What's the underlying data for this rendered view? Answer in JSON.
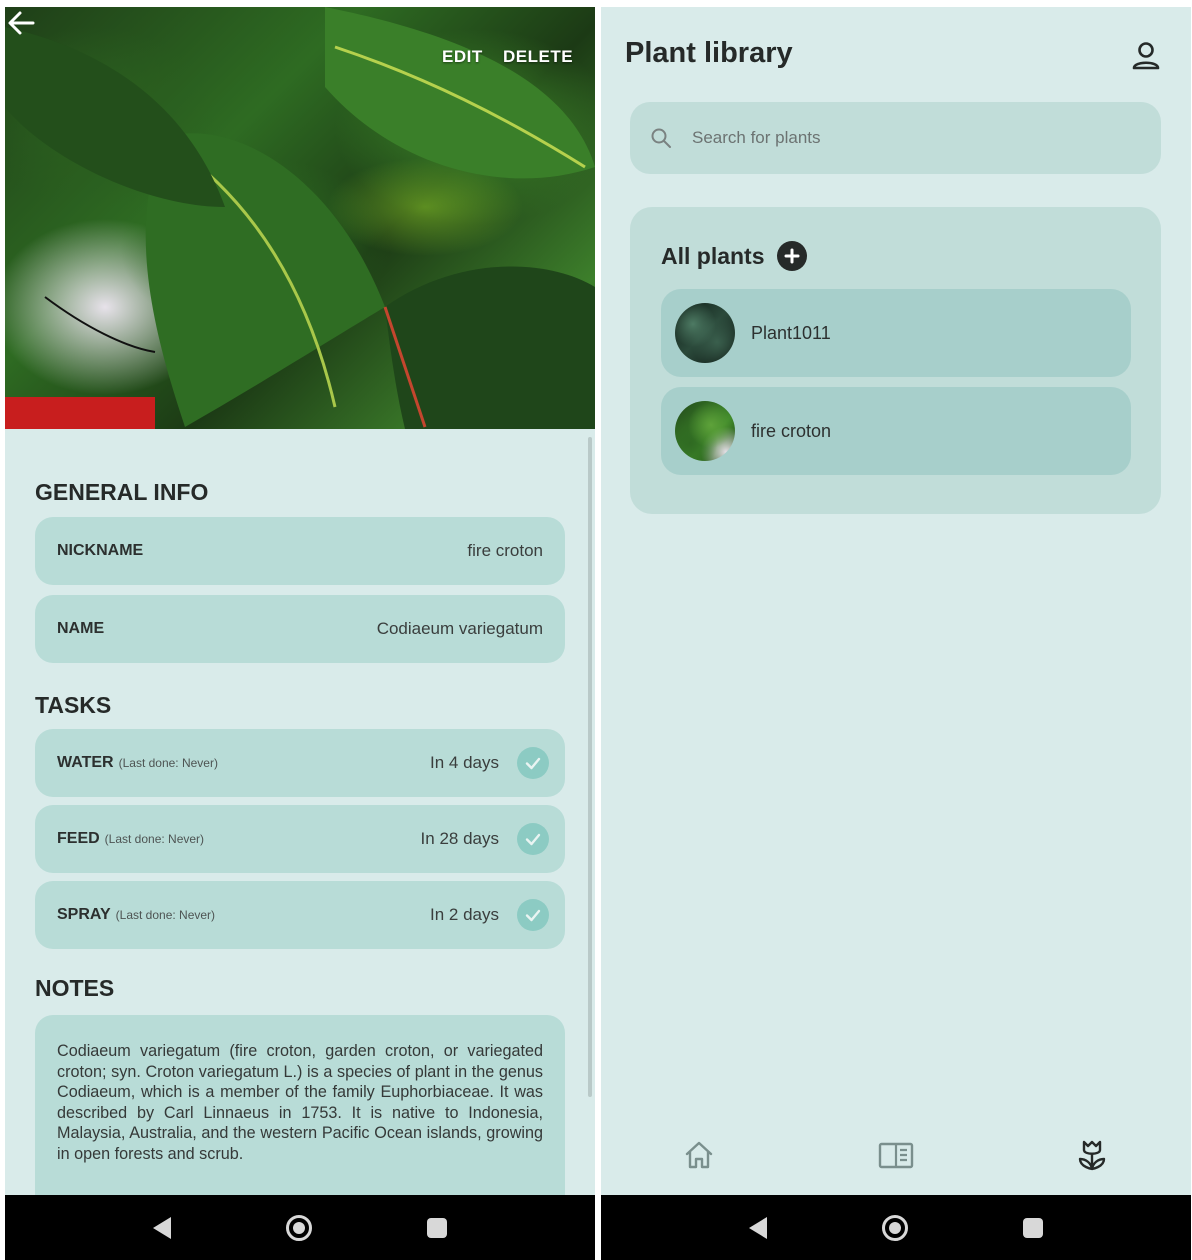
{
  "left": {
    "header": {
      "edit_label": "EDIT",
      "delete_label": "DELETE"
    },
    "general_info": {
      "title": "GENERAL INFO",
      "nickname_label": "NICKNAME",
      "nickname_value": "fire croton",
      "name_label": "NAME",
      "name_value": "Codiaeum variegatum"
    },
    "tasks": {
      "title": "TASKS",
      "items": [
        {
          "label": "WATER",
          "last_done": "(Last done: Never)",
          "due": "In 4 days"
        },
        {
          "label": "FEED",
          "last_done": "(Last done: Never)",
          "due": "In 28 days"
        },
        {
          "label": "SPRAY",
          "last_done": "(Last done: Never)",
          "due": "In 2 days"
        }
      ]
    },
    "notes": {
      "title": "NOTES",
      "text": "Codiaeum variegatum (fire croton, garden croton, or variegated croton; syn. Croton variegatum L.) is a species of plant in the genus Codiaeum, which is a member of the family Euphorbiaceae. It was described by Carl Linnaeus in 1753. It is native to Indonesia, Malaysia, Australia, and the western Pacific Ocean islands, growing in open forests and scrub."
    }
  },
  "right": {
    "title": "Plant library",
    "search": {
      "placeholder": "Search for plants"
    },
    "all_plants": {
      "title": "All plants",
      "plants": [
        {
          "name": "Plant1011"
        },
        {
          "name": "fire croton"
        }
      ]
    },
    "tabs": [
      "home-icon",
      "catalog-icon",
      "plant-icon"
    ]
  },
  "colors": {
    "background": "#d9ebea",
    "card": "#b8dcd7",
    "accent_check": "#8ccbc3",
    "text": "#262a29"
  }
}
